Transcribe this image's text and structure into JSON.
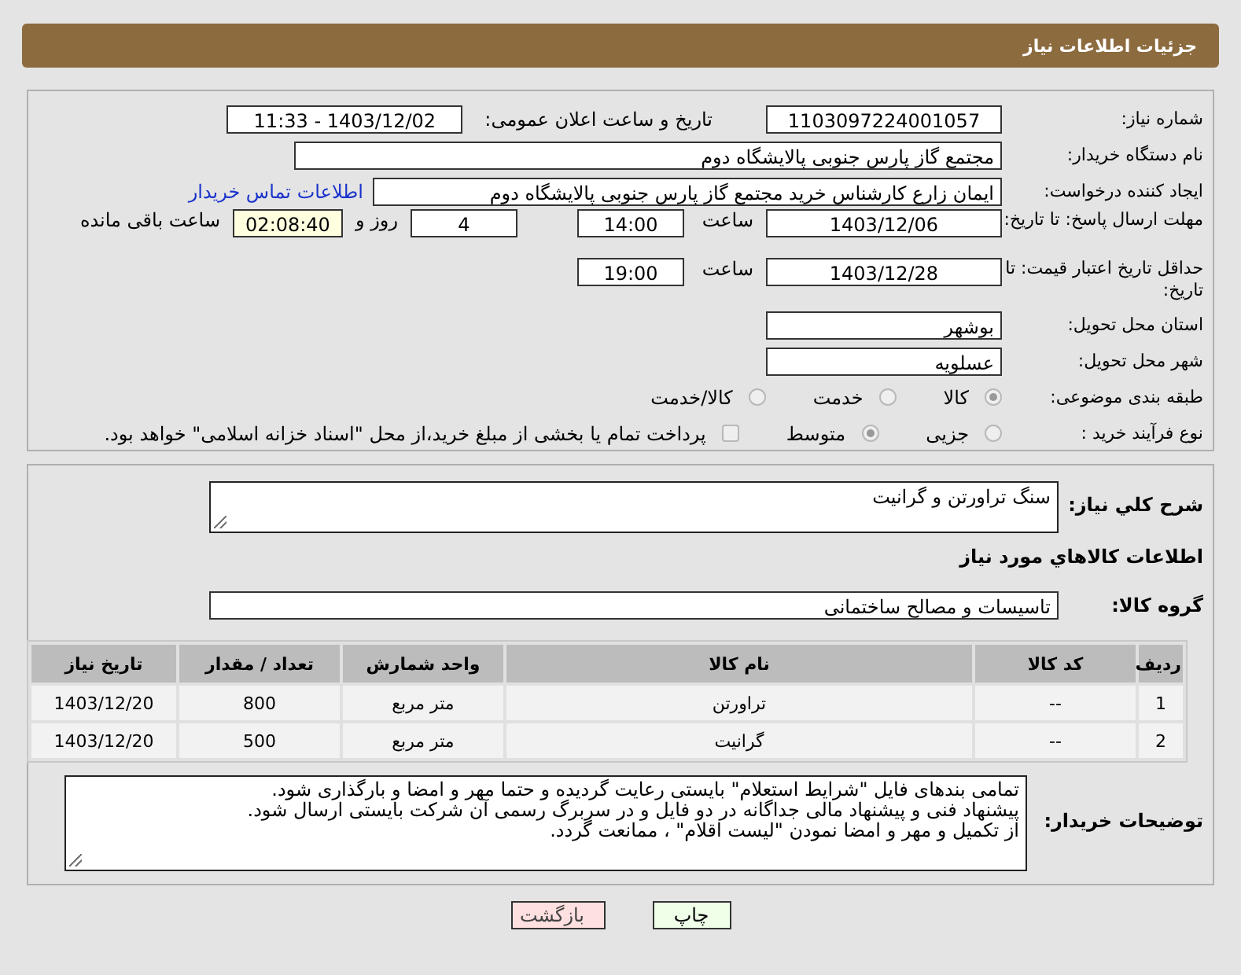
{
  "title": "جزئیات اطلاعات نیاز",
  "need_number": {
    "label": "شماره نیاز:",
    "value": "1103097224001057"
  },
  "announce": {
    "label": "تاریخ و ساعت اعلان عمومی:",
    "value": "1403/12/02 - 11:33"
  },
  "buyer": {
    "label": "نام دستگاه خریدار:",
    "value": "مجتمع گاز پارس جنوبی  پالایشگاه دوم"
  },
  "requester": {
    "label": "ایجاد کننده درخواست:",
    "value": "ایمان زارع کارشناس خرید مجتمع گاز پارس جنوبی  پالایشگاه دوم",
    "link": "اطلاعات تماس خریدار"
  },
  "reply_deadline": {
    "label": "مهلت ارسال پاسخ: تا تاریخ:",
    "date": "1403/12/06",
    "time_label": "ساعت",
    "time": "14:00",
    "days": "4",
    "days_label": "روز و",
    "remaining": "02:08:40",
    "remaining_label": "ساعت باقی مانده"
  },
  "validity": {
    "label": "حداقل تاریخ اعتبار قیمت: تا تاریخ:",
    "date": "1403/12/28",
    "time_label": "ساعت",
    "time": "19:00"
  },
  "province": {
    "label": "استان محل تحویل:",
    "value": "بوشهر"
  },
  "city": {
    "label": "شهر محل تحویل:",
    "value": "عسلویه"
  },
  "category": {
    "label": "طبقه بندی موضوعی:",
    "options": [
      {
        "label": "کالا",
        "selected": true
      },
      {
        "label": "خدمت",
        "selected": false
      },
      {
        "label": "کالا/خدمت",
        "selected": false
      }
    ]
  },
  "process": {
    "label": "نوع فرآیند خرید :",
    "options": [
      {
        "label": "جزیی",
        "selected": false
      },
      {
        "label": "متوسط",
        "selected": true
      }
    ],
    "payment": {
      "label": "پرداخت تمام یا بخشی از مبلغ خرید،از محل \"اسناد خزانه اسلامی\" خواهد بود.",
      "checked": false
    }
  },
  "summary": {
    "label": "شرح کلي نياز:",
    "value": "سنگ تراورتن و گرانیت"
  },
  "goods_heading": "اطلاعات کالاهاي مورد نياز",
  "group": {
    "label": "گروه کالا:",
    "value": "تاسیسات و مصالح ساختمانی"
  },
  "table": {
    "columns": [
      "ردیف",
      "کد کالا",
      "نام کالا",
      "واحد شمارش",
      "تعداد / مقدار",
      "تاریخ نیاز"
    ],
    "rows": [
      [
        "1",
        "--",
        "تراورتن",
        "متر مربع",
        "800",
        "1403/12/20"
      ],
      [
        "2",
        "--",
        "گرانیت",
        "متر مربع",
        "500",
        "1403/12/20"
      ]
    ]
  },
  "notes": {
    "label": "توضیحات خریدار:",
    "lines": [
      "تمامی بندهای فایل \"شرایط استعلام\" بایستی رعایت گردیده و حتما مهر و امضا و بارگذاری شود.",
      "پیشنهاد فنی و پیشنهاد مالی جداگانه در دو فایل و در سربرگ رسمی آن شرکت بایستی ارسال شود.",
      "از تکمیل و مهر و امضا نمودن \"لیست اقلام\" ، ممانعت گردد."
    ]
  },
  "buttons": [
    {
      "label": "چاپ",
      "kind": "print"
    },
    {
      "label": "بازگشت",
      "kind": "back"
    }
  ]
}
